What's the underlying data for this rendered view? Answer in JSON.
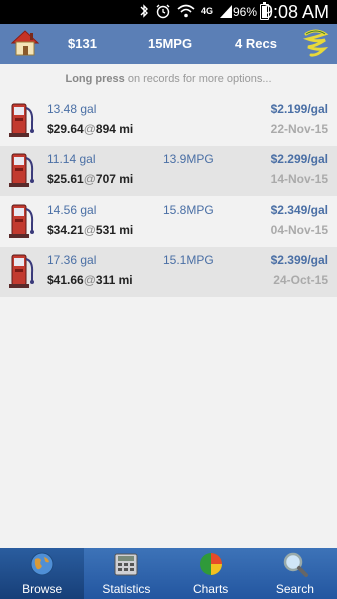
{
  "status_bar": {
    "battery": "96%",
    "time": "9:08 AM",
    "network": "4G"
  },
  "summary": {
    "total_cost": "$131",
    "avg_mpg": "15MPG",
    "record_count": "4 Recs"
  },
  "hint": {
    "bold": "Long press",
    "rest": " on records for more options..."
  },
  "records": [
    {
      "gallons": "13.48 gal",
      "mpg": "",
      "price": "$2.199/gal",
      "cost": "$29.64",
      "at": "@",
      "odometer": "894 mi",
      "date": "22-Nov-15"
    },
    {
      "gallons": "11.14 gal",
      "mpg": "13.9MPG",
      "price": "$2.299/gal",
      "cost": "$25.61",
      "at": "@",
      "odometer": "707 mi",
      "date": "14-Nov-15"
    },
    {
      "gallons": "14.56 gal",
      "mpg": "15.8MPG",
      "price": "$2.349/gal",
      "cost": "$34.21",
      "at": "@",
      "odometer": "531 mi",
      "date": "04-Nov-15"
    },
    {
      "gallons": "17.36 gal",
      "mpg": "15.1MPG",
      "price": "$2.399/gal",
      "cost": "$41.66",
      "at": "@",
      "odometer": "311 mi",
      "date": "24-Oct-15"
    }
  ],
  "nav": [
    {
      "label": "Browse",
      "icon": "globe-icon"
    },
    {
      "label": "Statistics",
      "icon": "calculator-icon"
    },
    {
      "label": "Charts",
      "icon": "pie-chart-icon"
    },
    {
      "label": "Search",
      "icon": "magnifier-icon"
    }
  ],
  "colors": {
    "header": "#5b7fb6",
    "nav": "#2f64aa",
    "accent_text": "#4a6fa5"
  }
}
